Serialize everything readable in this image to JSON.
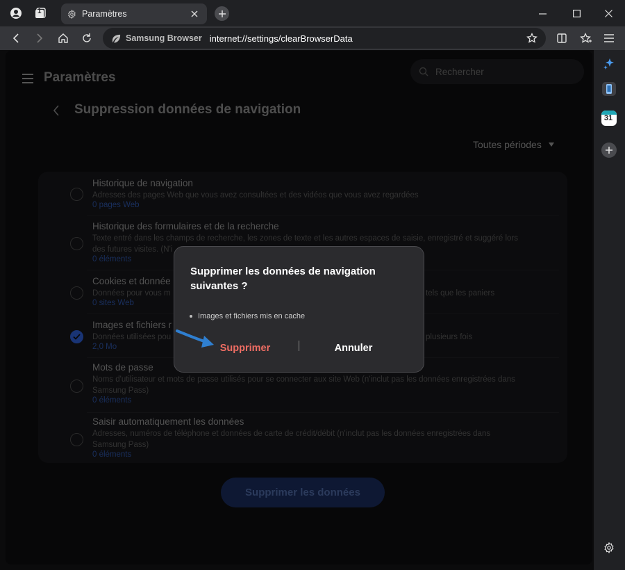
{
  "window": {
    "tab_title": "Paramètres",
    "tab_count": "1"
  },
  "toolbar": {
    "brand": "Samsung Browser",
    "url": "internet://settings/clearBrowserData"
  },
  "sidebar": {
    "calendar_day": "31"
  },
  "settings": {
    "heading": "Paramètres",
    "search_placeholder": "Rechercher",
    "sub_heading": "Suppression données de navigation",
    "period": "Toutes périodes",
    "items": [
      {
        "title": "Historique de navigation",
        "desc": "Adresses des pages Web que vous avez consultées et des vidéos que vous avez regardées",
        "meta": "0 pages Web",
        "checked": false
      },
      {
        "title": "Historique des formulaires et de la recherche",
        "desc": "Texte entré dans les champs de recherche, les zones de texte et les autres espaces de saisie, enregistré et suggéré lors des futures visites. (N'i",
        "meta": "0 éléments",
        "checked": false
      },
      {
        "title": "Cookies et donnée",
        "desc": "Données pour vous m",
        "desc_right": "tels que les paniers",
        "meta": "0 sites Web",
        "checked": false
      },
      {
        "title": "Images et fichiers r",
        "desc": "Données utilisées pou",
        "desc_right": "plusieurs fois",
        "meta": "2,0 Mo",
        "checked": true
      },
      {
        "title": "Mots de passe",
        "desc": "Noms d'utilisateur et mots de passe utilisés pour se connecter aux site Web (n'inclut pas les données enregistrées dans Samsung Pass)",
        "meta": "0 éléments",
        "checked": false
      },
      {
        "title": "Saisir automatiquement les données",
        "desc": "Adresses, numéros de téléphone et données de carte de crédit/débit (n'inclut pas les données enregistrées dans Samsung Pass)",
        "meta": "0 éléments",
        "checked": false
      }
    ],
    "delete_button": "Supprimer les données"
  },
  "dialog": {
    "title": "Supprimer les données de navigation suivantes ?",
    "bullet": "Images et fichiers mis en cache",
    "confirm": "Supprimer",
    "cancel": "Annuler"
  },
  "colors": {
    "accent": "#2f5fd6",
    "danger": "#ef6d63",
    "pointer": "#2f7fd0"
  }
}
